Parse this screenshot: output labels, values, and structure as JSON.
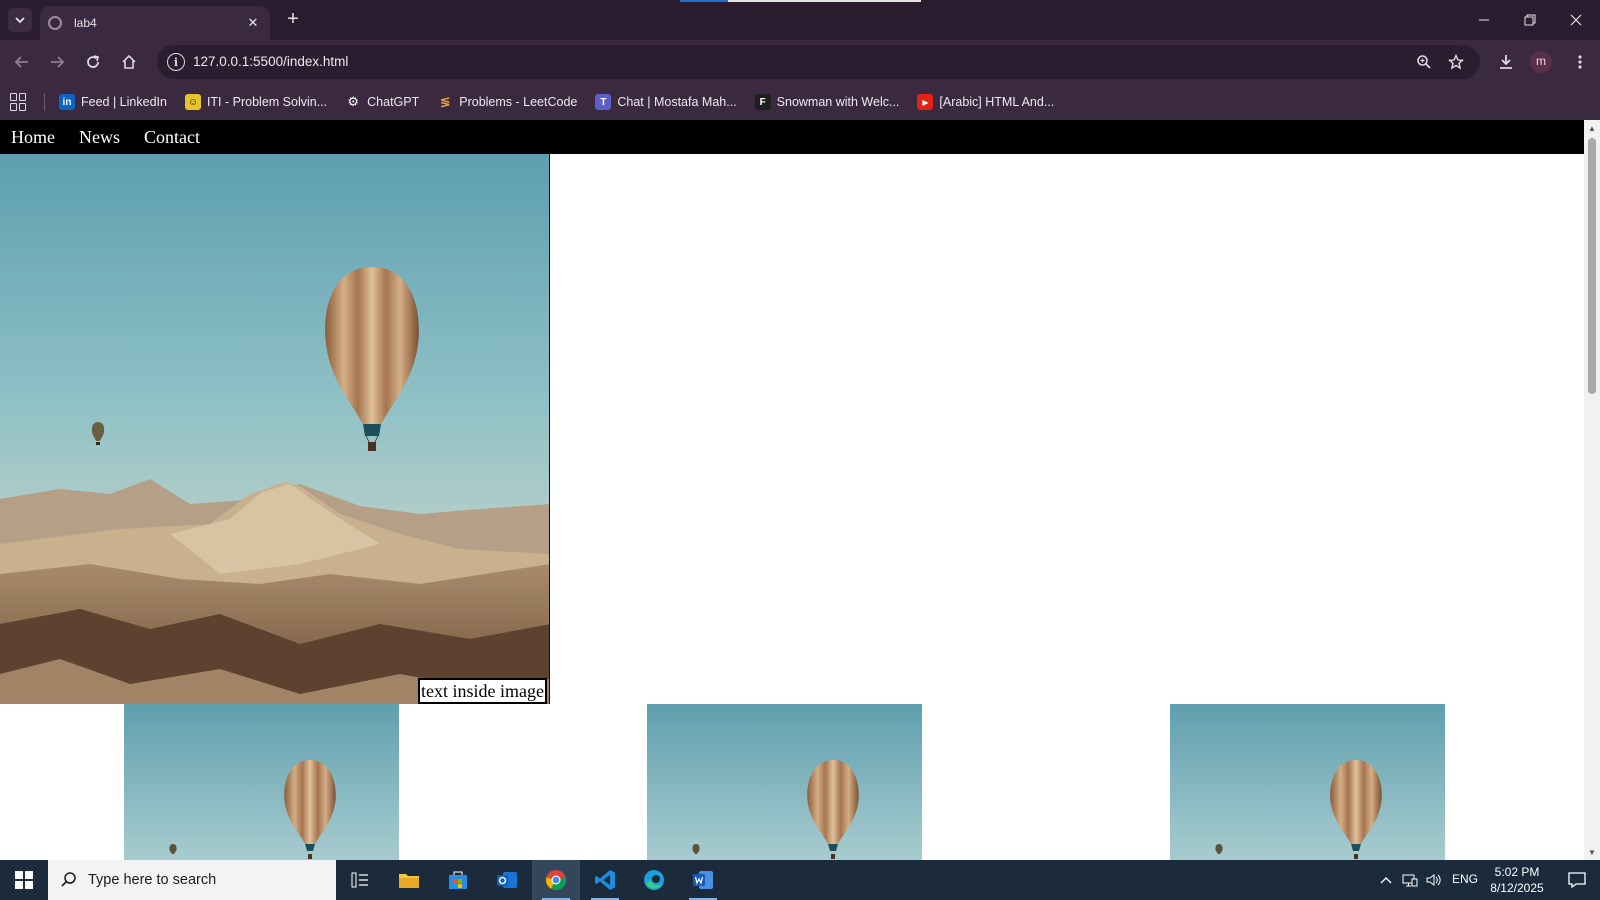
{
  "browser": {
    "tab_title": "lab4",
    "url": "127.0.0.1:5500/index.html",
    "avatar_letter": "m"
  },
  "bookmarks": [
    {
      "label": "Feed | LinkedIn",
      "icon": "linkedin-icon",
      "color": "#0a66c2",
      "glyph": "in"
    },
    {
      "label": "ITI - Problem Solvin...",
      "icon": "iti-icon",
      "color": "#e8c42b",
      "glyph": "☺"
    },
    {
      "label": "ChatGPT",
      "icon": "chatgpt-icon",
      "color": "#3b2a3f",
      "glyph": "⚙"
    },
    {
      "label": "Problems - LeetCode",
      "icon": "leetcode-icon",
      "color": "#3b2a3f",
      "glyph": "≶"
    },
    {
      "label": "Chat | Mostafa Mah...",
      "icon": "teams-icon",
      "color": "#5b5fc7",
      "glyph": "T"
    },
    {
      "label": "Snowman with Welc...",
      "icon": "figma-icon",
      "color": "#1e1e1e",
      "glyph": "F"
    },
    {
      "label": "[Arabic] HTML And...",
      "icon": "youtube-icon",
      "color": "#e62117",
      "glyph": "▶"
    }
  ],
  "site": {
    "nav": [
      "Home",
      "News",
      "Contact"
    ],
    "hero_caption": "text inside image"
  },
  "taskbar": {
    "search_placeholder": "Type here to search",
    "lang": "ENG",
    "time": "5:02 PM",
    "date": "8/12/2025"
  }
}
